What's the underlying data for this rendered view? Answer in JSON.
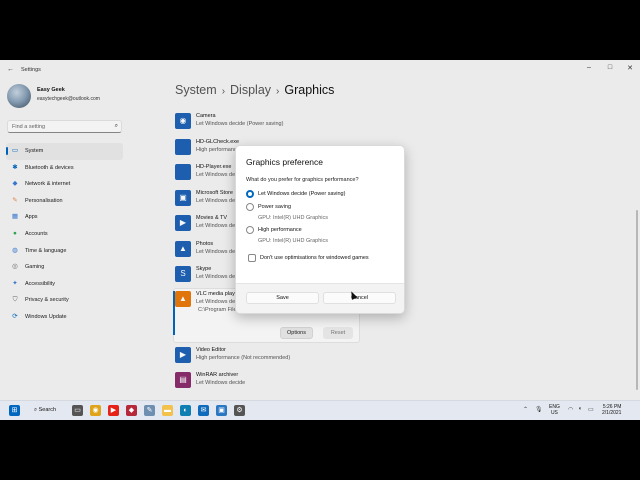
{
  "window": {
    "title": "Settings",
    "back_icon": "back-arrow-icon",
    "minimize": "–",
    "maximize": "□",
    "close": "✕"
  },
  "profile": {
    "name": "Easy Geek",
    "email": "easytechgeek@outlook.com"
  },
  "search": {
    "placeholder": "Find a setting",
    "icon": "search-icon"
  },
  "sidebar": {
    "items": [
      {
        "label": "System",
        "icon": "system-icon",
        "color": "#0067c0",
        "active": true
      },
      {
        "label": "Bluetooth & devices",
        "icon": "bluetooth-icon",
        "color": "#0067c0"
      },
      {
        "label": "Network & internet",
        "icon": "wifi-icon",
        "color": "#3a7bd5"
      },
      {
        "label": "Personalisation",
        "icon": "brush-icon",
        "color": "#e8894c"
      },
      {
        "label": "Apps",
        "icon": "apps-icon",
        "color": "#3a7bd5"
      },
      {
        "label": "Accounts",
        "icon": "accounts-icon",
        "color": "#2fa84f"
      },
      {
        "label": "Time & language",
        "icon": "globe-icon",
        "color": "#3a7bd5"
      },
      {
        "label": "Gaming",
        "icon": "gaming-icon",
        "color": "#666666"
      },
      {
        "label": "Accessibility",
        "icon": "accessibility-icon",
        "color": "#3a7bd5"
      },
      {
        "label": "Privacy & security",
        "icon": "shield-icon",
        "color": "#666666"
      },
      {
        "label": "Windows Update",
        "icon": "update-icon",
        "color": "#0067c0"
      }
    ]
  },
  "breadcrumb": {
    "items": [
      "System",
      "Display",
      "Graphics"
    ],
    "separator": "›"
  },
  "apps": [
    {
      "name": "Camera",
      "status": "Let Windows decide (Power saving)",
      "icon": "camera-icon",
      "color": "#1e62b4"
    },
    {
      "name": "HD-GLCheck.exe",
      "status": "High performance",
      "icon": "exe-icon",
      "color": "#1e62b4"
    },
    {
      "name": "HD-Player.exe",
      "status": "Let Windows decide",
      "icon": "exe-icon",
      "color": "#1e62b4"
    },
    {
      "name": "Microsoft Store",
      "status": "Let Windows decide",
      "icon": "store-icon",
      "color": "#1e62b4"
    },
    {
      "name": "Movies & TV",
      "status": "Let Windows decide",
      "icon": "movies-icon",
      "color": "#1e62b4"
    },
    {
      "name": "Photos",
      "status": "Let Windows decide",
      "icon": "photos-icon",
      "color": "#1e62b4"
    },
    {
      "name": "Skype",
      "status": "Let Windows decide",
      "icon": "skype-icon",
      "color": "#1e62b4"
    },
    {
      "name": "VLC media play",
      "status": "Let Windows dec",
      "path": "C:\\Program File",
      "icon": "vlc-icon",
      "color": "#e8790c"
    },
    {
      "name": "Video Editor",
      "status": "High performance (Not recommended)",
      "icon": "video-editor-icon",
      "color": "#1e62b4"
    },
    {
      "name": "WinRAR archiver",
      "status": "Let Windows decide",
      "icon": "winrar-icon",
      "color": "#8a2d6e"
    }
  ],
  "app_actions": {
    "options": "Options",
    "reset": "Reset"
  },
  "dialog": {
    "title": "Graphics preference",
    "question": "What do you prefer for graphics performance?",
    "options": [
      {
        "label": "Let Windows decide (Power saving)",
        "sub": "",
        "checked": true
      },
      {
        "label": "Power saving",
        "sub": "GPU: Intel(R) UHD Graphics",
        "checked": false
      },
      {
        "label": "High performance",
        "sub": "GPU: Intel(R) UHD Graphics",
        "checked": false
      }
    ],
    "checkbox_label": "Don't use optimisations for windowed games",
    "save": "Save",
    "cancel": "Cancel"
  },
  "taskbar": {
    "search_label": "Search",
    "language": "ENG",
    "region": "US",
    "time": "5:26 PM",
    "date": "2/1/2021",
    "accent": "#0067c0"
  }
}
